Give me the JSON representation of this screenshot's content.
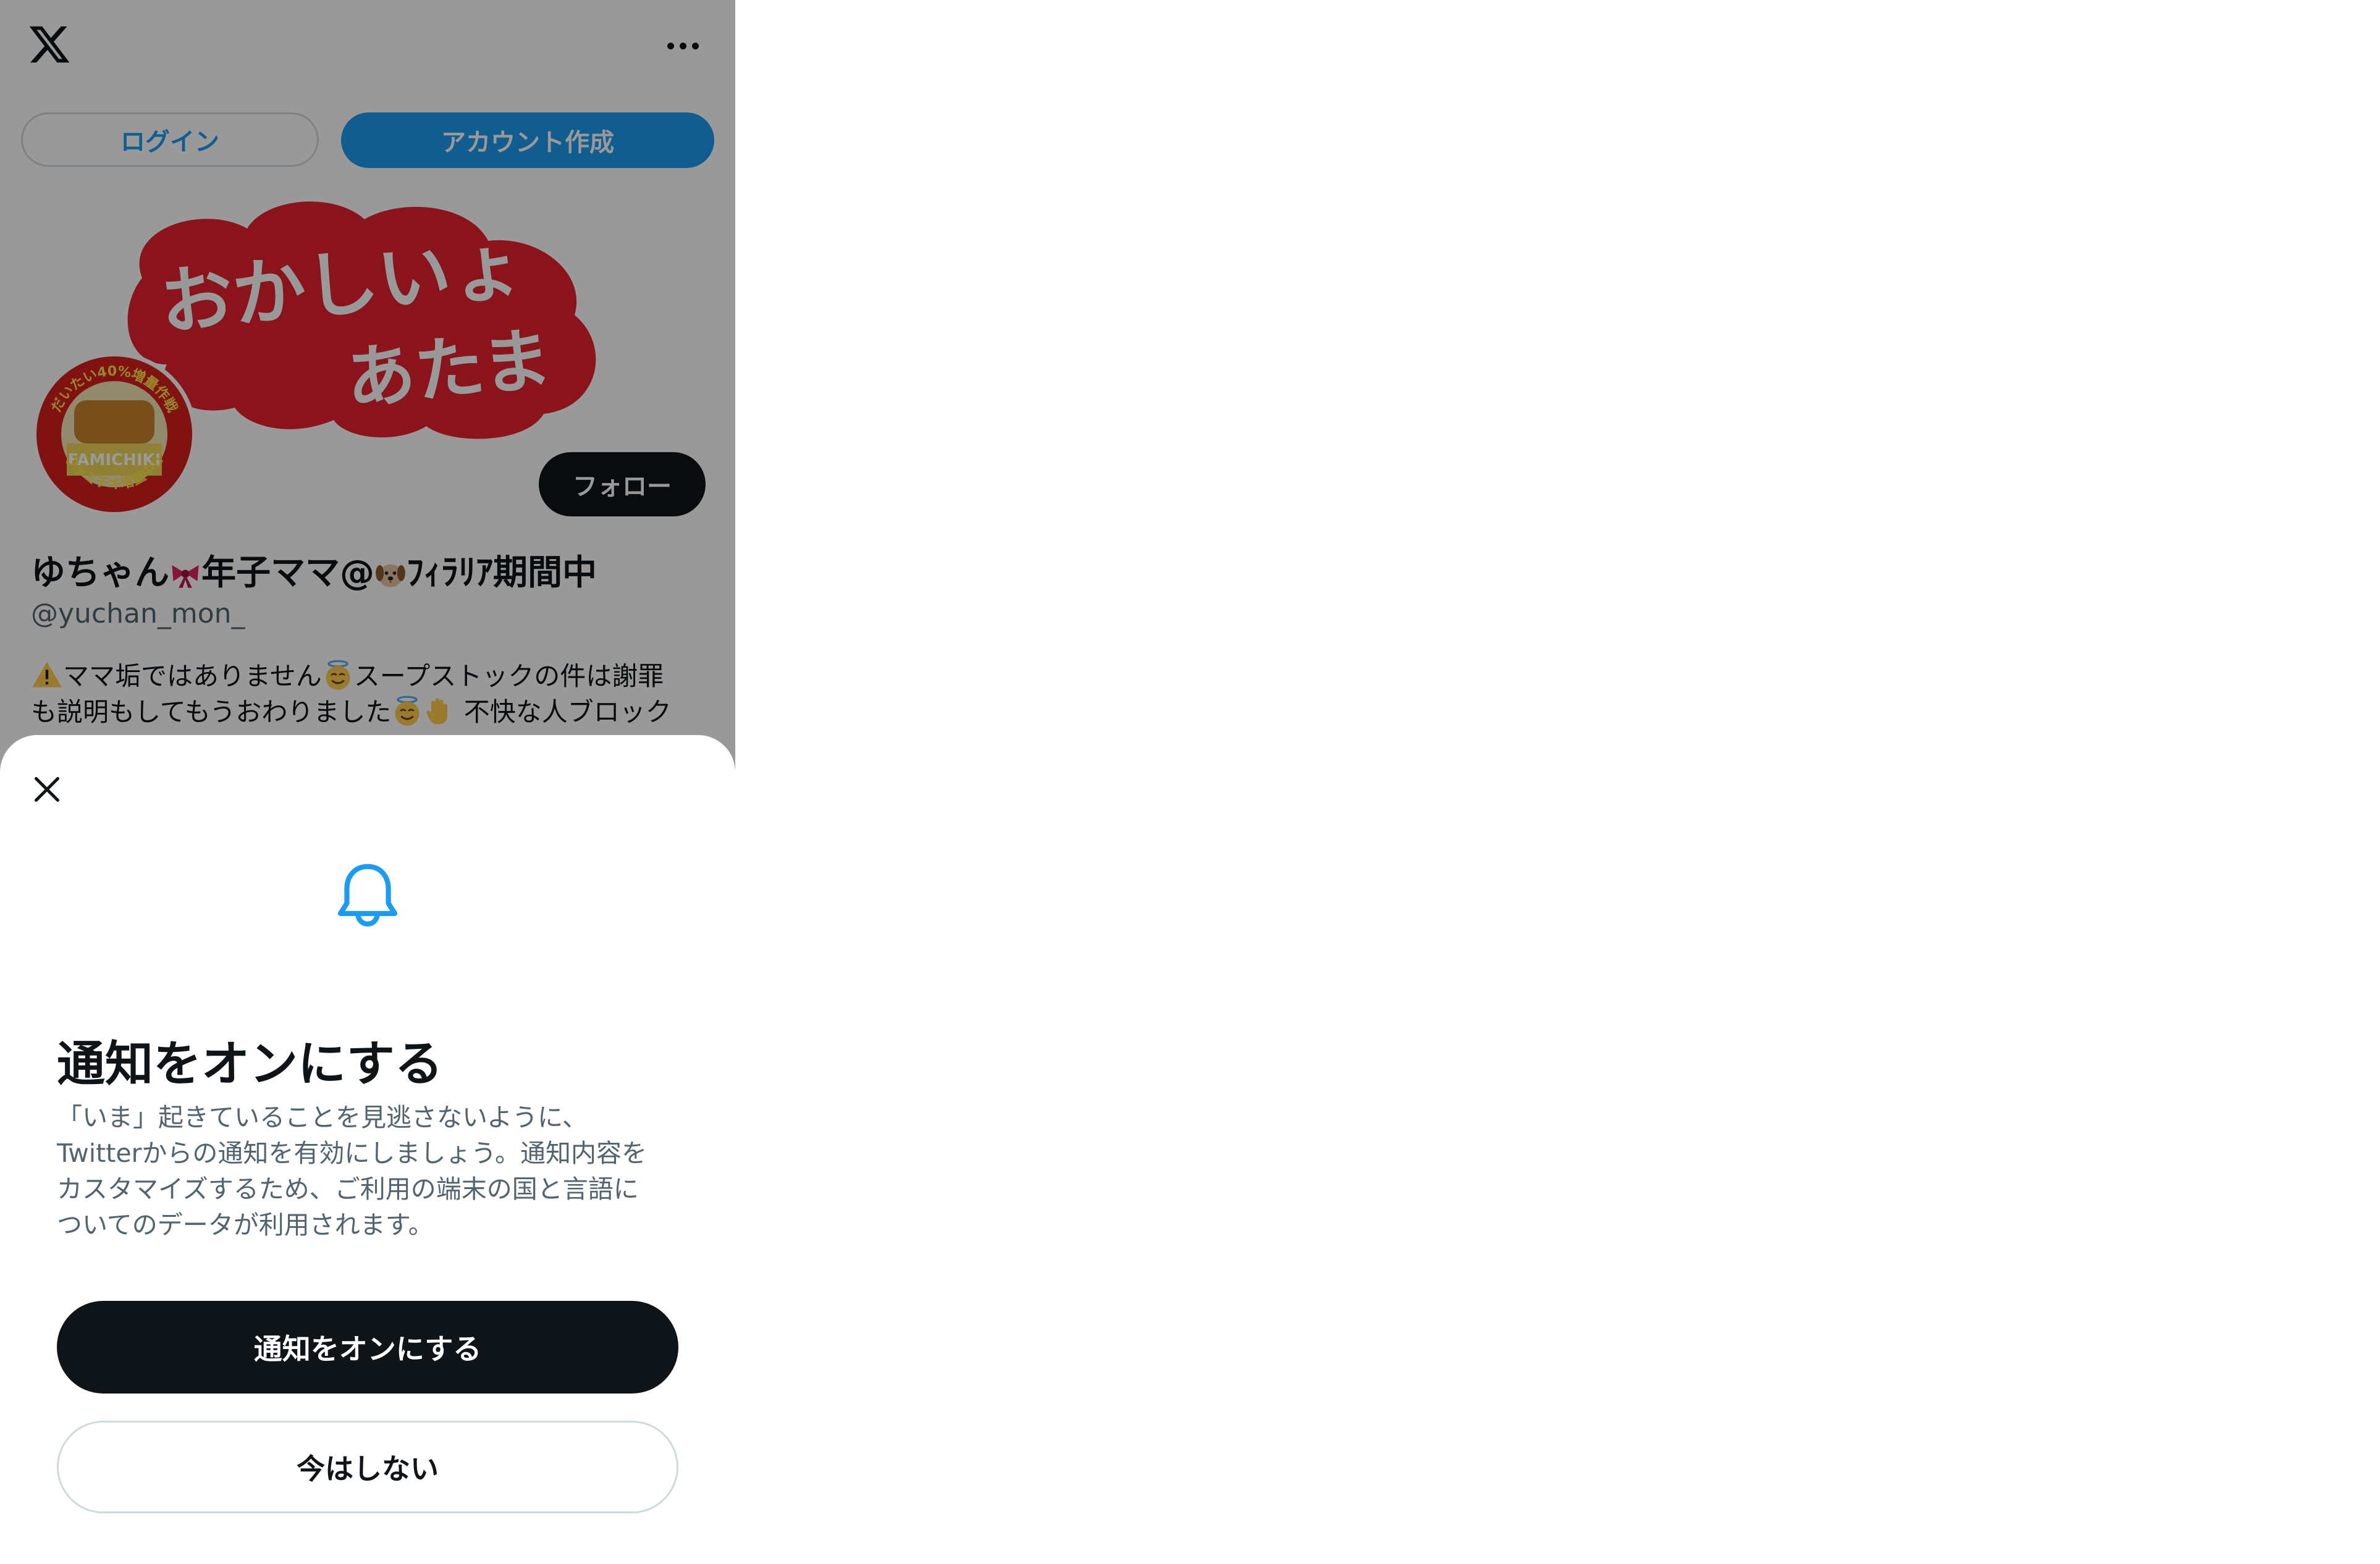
{
  "topbar": {
    "logo": "x-logo-icon",
    "more": "more-icon"
  },
  "auth": {
    "login_label": "ログイン",
    "signup_label": "アカウント作成"
  },
  "profile": {
    "banner": {
      "line1": "おかしいょ",
      "line2": "あたま"
    },
    "avatar": {
      "ring_top": "だいたい40%増量作戦",
      "center": "FAMICHIKI",
      "ring_bottom": "ファミチキ増量中!!"
    },
    "follow_label": "フォロー",
    "display_name_a": "ゆちゃん",
    "display_name_b": "年子ママ@",
    "display_name_c": "ﾌｨﾗﾘｱ期間中",
    "handle": "@yuchan_mon_",
    "bio_line1_a": "ママ垢ではありません",
    "bio_line1_b": "スープストックの件は謝罪",
    "bio_line2_a": "も説明もしてもうおわりました",
    "bio_line2_b": " 不快な人ブロック"
  },
  "sheet": {
    "close": "close-icon",
    "icon": "bell-icon",
    "title": "通知をオンにする",
    "description": [
      "「いま」起きていることを見逃さないように、",
      "Twitterからの通知を有効にしましょう。通知内容を",
      "カスタマイズするため、ご利用の端末の国と言語に",
      "ついてのデータが利用されます。"
    ],
    "enable_label": "通知をオンにする",
    "later_label": "今はしない"
  },
  "colors": {
    "accent": "#1d9bf0",
    "dark": "#0f1419",
    "muted": "#536471",
    "border": "#cfd9de",
    "banner_red": "#e8202d"
  }
}
